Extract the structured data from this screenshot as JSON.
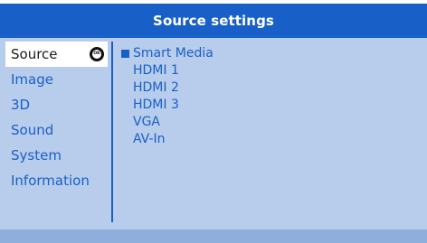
{
  "header": {
    "title": "Source settings"
  },
  "left_menu": {
    "items": [
      {
        "label": "Source",
        "selected": true
      },
      {
        "label": "Image",
        "selected": false
      },
      {
        "label": "3D",
        "selected": false
      },
      {
        "label": "Sound",
        "selected": false
      },
      {
        "label": "System",
        "selected": false
      },
      {
        "label": "Information",
        "selected": false
      }
    ],
    "ok_icon_label": "OK"
  },
  "sub_menu": {
    "items": [
      {
        "label": "Smart Media",
        "marked": true
      },
      {
        "label": "HDMI 1",
        "marked": false
      },
      {
        "label": "HDMI 2",
        "marked": false
      },
      {
        "label": "HDMI 3",
        "marked": false
      },
      {
        "label": "VGA",
        "marked": false
      },
      {
        "label": "AV-In",
        "marked": false
      }
    ]
  },
  "colors": {
    "panel_background": "#b8ccec",
    "title_bar": "#1860c8",
    "accent_text": "#1860c8",
    "selected_background": "#ffffff",
    "bottom_bar": "#8eaedc"
  },
  "icons": {
    "ok_button": "ok-icon",
    "selection_marker": "square-marker-icon"
  }
}
